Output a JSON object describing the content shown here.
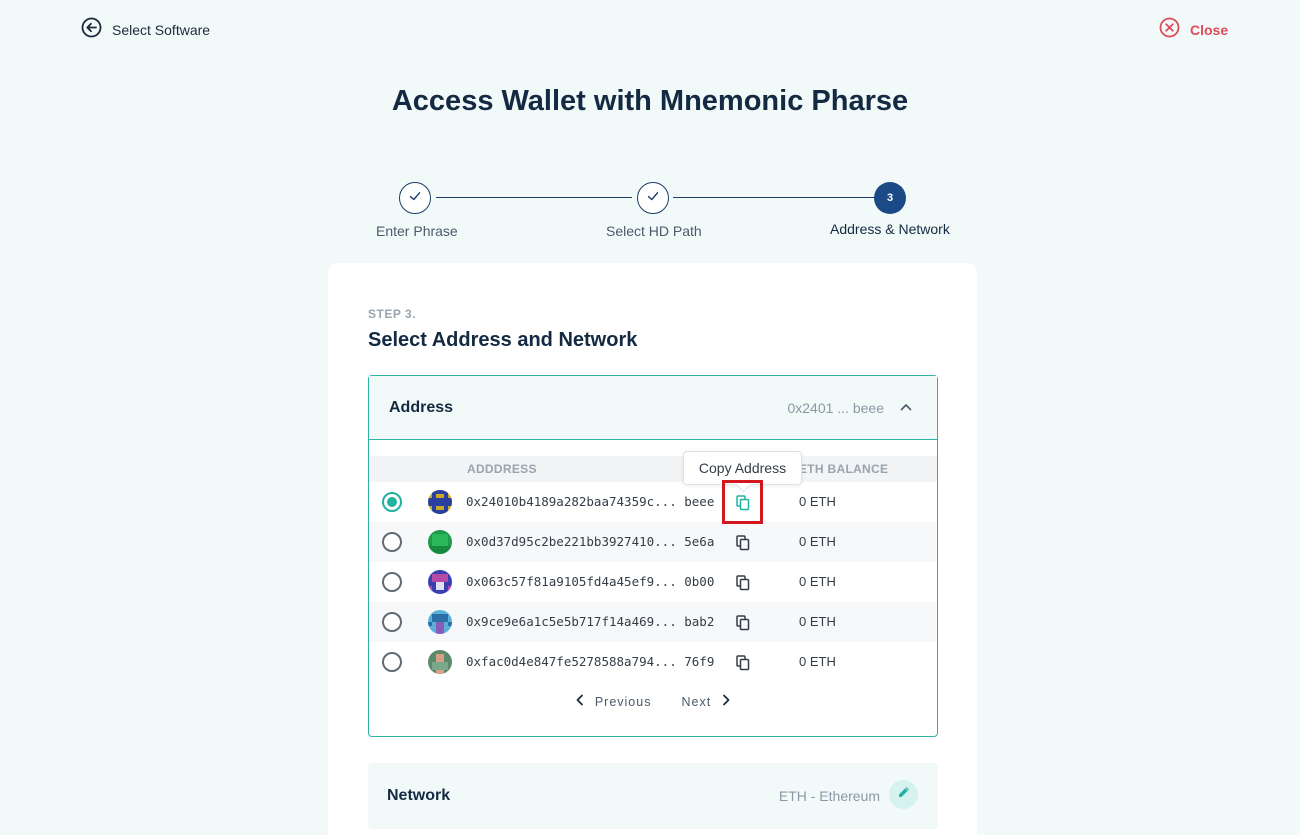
{
  "header": {
    "back_label": "Select Software",
    "close_label": "Close"
  },
  "title": "Access Wallet with Mnemonic Pharse",
  "stepper": {
    "steps": [
      {
        "label": "Enter Phrase",
        "state": "done"
      },
      {
        "label": "Select HD Path",
        "state": "done"
      },
      {
        "label": "Address & Network",
        "state": "active",
        "number": "3"
      }
    ]
  },
  "card": {
    "kicker": "STEP 3.",
    "title": "Select Address and Network",
    "address_panel": {
      "title": "Address",
      "selected_short": "0x2401 ... beee",
      "columns": [
        "ADDDRESS",
        "ETH BALANCE"
      ],
      "tooltip": "Copy Address",
      "rows": [
        {
          "address": "0x24010b4189a282baa74359c... beee",
          "balance": "0 ETH",
          "selected": true
        },
        {
          "address": "0x0d37d95c2be221bb3927410... 5e6a",
          "balance": "0 ETH",
          "selected": false
        },
        {
          "address": "0x063c57f81a9105fd4a45ef9... 0b00",
          "balance": "0 ETH",
          "selected": false
        },
        {
          "address": "0x9ce9e6a1c5e5b717f14a469... bab2",
          "balance": "0 ETH",
          "selected": false
        },
        {
          "address": "0xfac0d4e847fe5278588a794... 76f9",
          "balance": "0 ETH",
          "selected": false
        }
      ],
      "pager": {
        "previous": "Previous",
        "next": "Next"
      }
    },
    "network_panel": {
      "title": "Network",
      "value": "ETH - Ethereum"
    }
  },
  "colors": {
    "accent": "#1fb3a0",
    "brand_dark": "#1b4a86",
    "close_red": "#e04a5a",
    "highlight_red": "#d4171e"
  },
  "icons": [
    "arrow-left-circle-icon",
    "close-circle-icon",
    "check-icon",
    "chevron-up-icon",
    "copy-icon",
    "chevron-left-icon",
    "chevron-right-icon",
    "pencil-icon"
  ]
}
